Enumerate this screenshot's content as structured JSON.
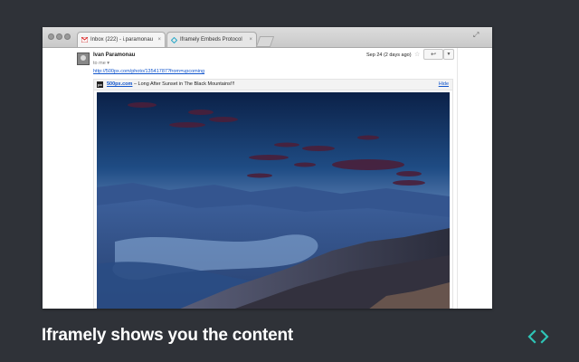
{
  "browser": {
    "tabs": [
      {
        "label": "Inbox (222) - i.paramonau",
        "active": true,
        "favicon": "gmail-icon"
      },
      {
        "label": "Iframely Embeds Protocol",
        "active": false,
        "favicon": "iframely-icon"
      }
    ]
  },
  "email": {
    "sender": "Ivan Paramonau",
    "to": "to me",
    "date": "Sep 24 (2 days ago)",
    "link": "http://500px.com/photo/13541787?from=upcoming"
  },
  "embed": {
    "source": "500px.com",
    "title": " – Long After Sunset in The Black Mountains!!!",
    "hide_label": "Hide",
    "icon_label": "px"
  },
  "caption": "Iframely shows you the content",
  "colors": {
    "background": "#2f3238",
    "accent": "#2ec4b6",
    "link": "#1155cc"
  }
}
